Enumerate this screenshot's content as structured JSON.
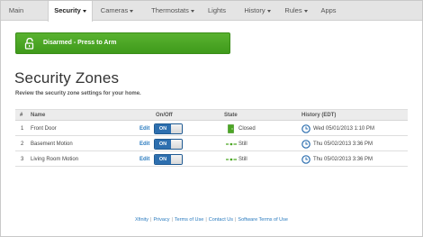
{
  "nav": {
    "items": [
      {
        "label": "Main",
        "dropdown": false,
        "active": false
      },
      {
        "label": "Security",
        "dropdown": true,
        "active": true
      },
      {
        "label": "Cameras",
        "dropdown": true,
        "active": false
      },
      {
        "label": "Thermostats",
        "dropdown": true,
        "active": false
      },
      {
        "label": "Lights",
        "dropdown": false,
        "active": false
      },
      {
        "label": "History",
        "dropdown": true,
        "active": false
      },
      {
        "label": "Rules",
        "dropdown": true,
        "active": false
      },
      {
        "label": "Apps",
        "dropdown": false,
        "active": false
      }
    ]
  },
  "arm_button": {
    "label": "Disarmed - Press to Arm",
    "icon": "unlock-icon",
    "color": "#4ca624"
  },
  "page": {
    "title": "Security Zones",
    "subtitle": "Review the security zone settings for your home."
  },
  "table": {
    "headers": {
      "num": "#",
      "name": "Name",
      "onoff": "On/Off",
      "state": "State",
      "history": "History (EDT)"
    },
    "rows": [
      {
        "num": "1",
        "name": "Front Door",
        "edit": "Edit",
        "toggle": "ON",
        "state_icon": "door-icon",
        "state": "Closed",
        "history": "Wed 05/01/2013 1:10 PM"
      },
      {
        "num": "2",
        "name": "Basement Motion",
        "edit": "Edit",
        "toggle": "ON",
        "state_icon": "motion-icon",
        "state": "Still",
        "history": "Thu 05/02/2013 3:36 PM"
      },
      {
        "num": "3",
        "name": "Living Room Motion",
        "edit": "Edit",
        "toggle": "ON",
        "state_icon": "motion-icon",
        "state": "Still",
        "history": "Thu 05/02/2013 3:36 PM"
      }
    ]
  },
  "footer": {
    "links": [
      "Xfinity",
      "Privacy",
      "Terms of Use",
      "Contact Us",
      "Software Terms of Use"
    ]
  },
  "colors": {
    "accent": "#2a7bbf",
    "toggle": "#2d6faf",
    "arm": "#4ca624"
  }
}
